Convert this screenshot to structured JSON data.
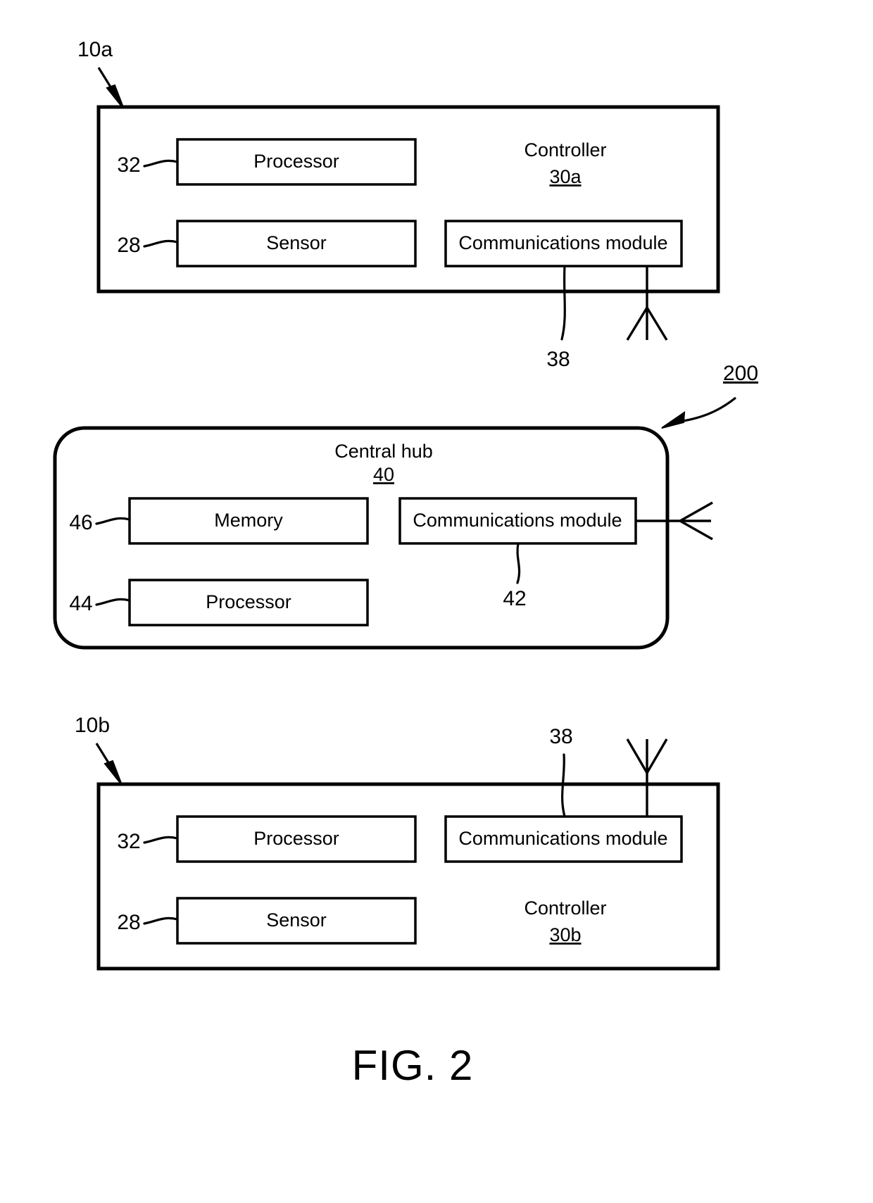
{
  "figure": {
    "caption": "FIG. 2",
    "system_ref": "200"
  },
  "controller_a": {
    "device_ref": "10a",
    "title": "Controller",
    "title_ref": "30a",
    "boxes": [
      {
        "label": "Processor",
        "ref": "32"
      },
      {
        "label": "Sensor",
        "ref": "28"
      },
      {
        "label": "Communications module",
        "ref": "38"
      }
    ],
    "antenna_ref": ""
  },
  "central_hub": {
    "title": "Central hub",
    "title_ref": "40",
    "boxes": [
      {
        "label": "Memory",
        "ref": "46"
      },
      {
        "label": "Processor",
        "ref": "44"
      },
      {
        "label": "Communications module",
        "ref": "42"
      }
    ]
  },
  "controller_b": {
    "device_ref": "10b",
    "title": "Controller",
    "title_ref": "30b",
    "boxes": [
      {
        "label": "Processor",
        "ref": "32"
      },
      {
        "label": "Sensor",
        "ref": "28"
      },
      {
        "label": "Communications module",
        "ref": "38"
      }
    ]
  },
  "colors": {
    "stroke": "#000000",
    "background": "#ffffff"
  }
}
